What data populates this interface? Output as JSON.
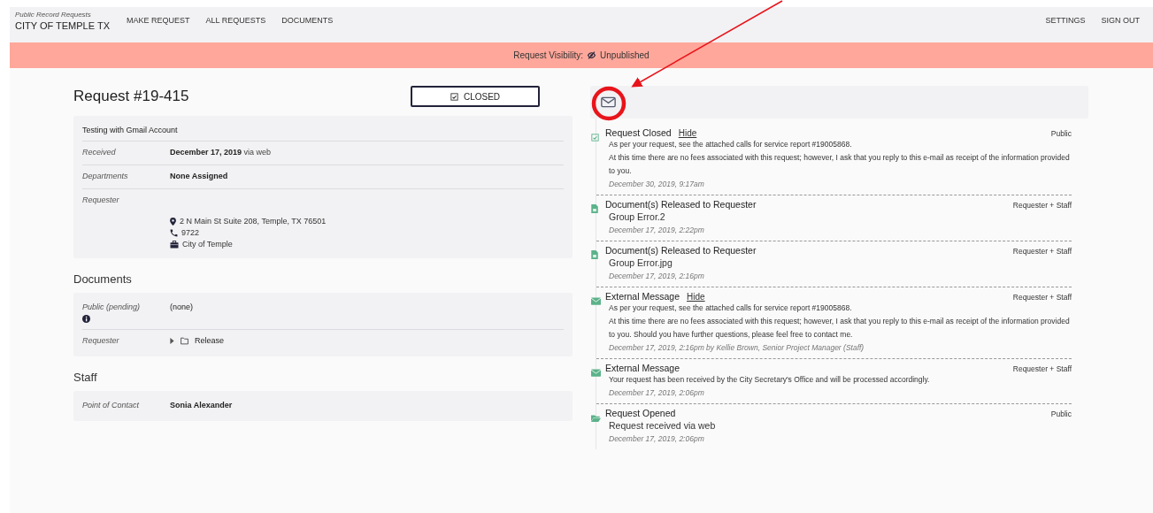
{
  "nav": {
    "subtitle": "Public Record Requests",
    "title": "CITY OF TEMPLE TX",
    "links": [
      "MAKE REQUEST",
      "ALL REQUESTS",
      "DOCUMENTS"
    ],
    "right_links": [
      "SETTINGS",
      "SIGN OUT"
    ]
  },
  "banner": {
    "label": "Request Visibility:",
    "value": "Unpublished"
  },
  "request": {
    "title": "Request #19-415",
    "status_button": "CLOSED"
  },
  "details": {
    "description": "Testing with Gmail Account",
    "rows": [
      {
        "kind": "text",
        "label": "Received",
        "value": "December 17, 2019",
        "note": "via web"
      },
      {
        "kind": "text",
        "label": "Departments",
        "value": "None Assigned"
      },
      {
        "kind": "contact",
        "label": "Requester",
        "contact": [
          {
            "kind": "address",
            "text": "2 N Main St Suite 208, Temple, TX 76501"
          },
          {
            "kind": "phone",
            "text": "9722"
          },
          {
            "kind": "company",
            "text": "City of Temple"
          }
        ]
      }
    ]
  },
  "documents": {
    "heading": "Documents",
    "rows": [
      {
        "kind": "pending",
        "label": "Public (pending)",
        "value": "(none)"
      },
      {
        "kind": "folder",
        "label": "Requester",
        "value": "Release"
      }
    ]
  },
  "staff": {
    "heading": "Staff",
    "rows": [
      {
        "kind": "text",
        "label": "Point of Contact",
        "value": "Sonia Alexander"
      }
    ]
  },
  "timeline": [
    {
      "kind": "closed",
      "title": "Request Closed",
      "link": "Hide",
      "visibility": "Public",
      "body": [
        "As per your request, see the attached calls for service report #19005868.",
        "At this time there are no fees associated with this request; however, I ask that you reply to this e-mail as receipt of the information provided to you."
      ],
      "meta": "December 30, 2019, 9:17am"
    },
    {
      "kind": "document",
      "title": "Document(s) Released to Requester",
      "visibility": "Requester + Staff",
      "body": [
        "Group Error.2"
      ],
      "meta": "December 17, 2019, 2:22pm"
    },
    {
      "kind": "document",
      "title": "Document(s) Released to Requester",
      "visibility": "Requester + Staff",
      "body": [
        "Group Error.jpg"
      ],
      "meta": "December 17, 2019, 2:16pm"
    },
    {
      "kind": "message",
      "title": "External Message",
      "link": "Hide",
      "visibility": "Requester + Staff",
      "body": [
        "As per your request, see the attached calls for service report #19005868.",
        "At this time there are no fees associated with this request; however, I ask that you reply to this e-mail as receipt of the information provided to you. Should you have further questions, please feel free to contact me."
      ],
      "meta": "December 17, 2019, 2:16pm by Kellie Brown, Senior Project Manager (Staff)"
    },
    {
      "kind": "message",
      "title": "External Message",
      "visibility": "Requester + Staff",
      "body": [
        "Your request has been received by the City Secretary's Office and will be processed accordingly."
      ],
      "meta": "December 17, 2019, 2:06pm"
    },
    {
      "kind": "opened",
      "title": "Request Opened",
      "visibility": "Public",
      "body": [
        "Request received via web"
      ],
      "meta": "December 17, 2019, 2:06pm"
    }
  ]
}
